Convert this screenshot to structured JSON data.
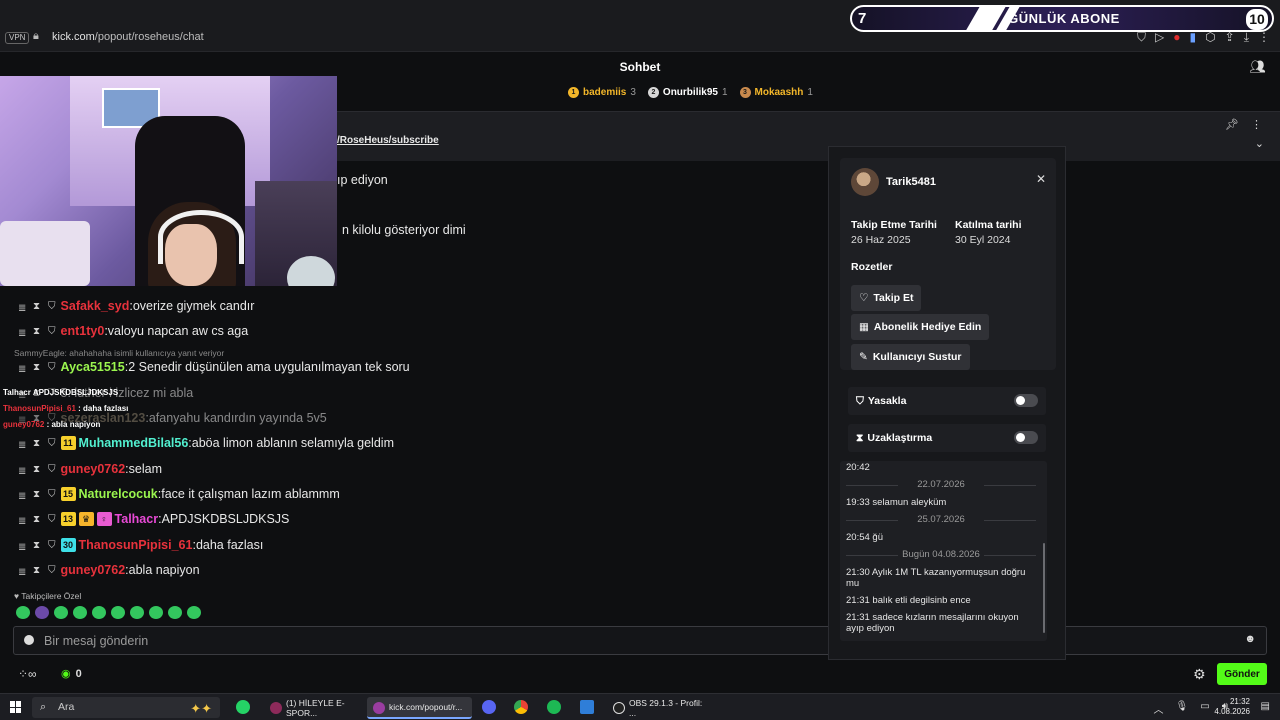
{
  "browser": {
    "vpn": "VPN",
    "url_host": "kick.com",
    "url_path": "/popout/roseheus/chat"
  },
  "overlay": {
    "left_number": "7",
    "title": "GÜNLÜK ABONE",
    "right_number": "10"
  },
  "header": {
    "title": "Sohbet"
  },
  "leaderboard": [
    {
      "rank": "1",
      "name": "bademiis",
      "count": "3",
      "color": "#f3b72a",
      "medal": "#f3b72a"
    },
    {
      "rank": "2",
      "name": "Onurbilik95",
      "count": "1",
      "color": "#ffffff",
      "medal": "#d7d7d7"
    },
    {
      "rank": "3",
      "name": "Mokaashh",
      "count": "1",
      "color": "#f3b72a",
      "medal": "#c98a4d"
    }
  ],
  "pinned": {
    "link": "/RoseHeus/subscribe"
  },
  "partials": [
    {
      "text": "ıp ediyon"
    },
    {
      "text": "n kilolu gösteriyor dimi"
    }
  ],
  "messages": [
    {
      "user": "Safakk_syd",
      "color": "#e8323c",
      "text": "overize giymek candır",
      "badges": []
    },
    {
      "user": "ent1ty0",
      "color": "#e8323c",
      "text": "valoyu napcan aw cs aga",
      "badges": []
    },
    {
      "user": "Ayca51515",
      "color": "#9bf64f",
      "text": "2 Senedir düşünülen ama uygulanılmayan tek soru",
      "badges": []
    },
    {
      "user": "",
      "color": "#e8e8e8",
      "text": "5: luther i izlicez mi abla",
      "badges": []
    },
    {
      "user": "sezeraslan123",
      "color": "#8a7f6a",
      "text": "afanyahu kandırdın yayında 5v5",
      "badges": []
    },
    {
      "user": "MuhammedBilal56",
      "color": "#52f0d0",
      "text": "aböa limon ablanın selamıyla geldim",
      "badges": [
        {
          "label": "11",
          "bg": "#f7d02c"
        }
      ]
    },
    {
      "user": "guney0762",
      "color": "#e8323c",
      "text": "selam",
      "badges": []
    },
    {
      "user": "Naturelcocuk",
      "color": "#9bf64f",
      "text": "face it çalışman lazım ablammm",
      "badges": [
        {
          "label": "15",
          "bg": "#f7d02c"
        }
      ]
    },
    {
      "user": "Talhacr",
      "color": "#e84ad6",
      "text": "APDJSKDBSLJDKSJS",
      "badges": [
        {
          "label": "13",
          "bg": "#f7d02c"
        },
        {
          "label": "♛",
          "bg": "#f7b52c"
        },
        {
          "label": "♀",
          "bg": "#e85bd1"
        }
      ]
    },
    {
      "user": "ThanosunPipisi_61",
      "color": "#e8323c",
      "text": "daha fazlası",
      "badges": [
        {
          "label": "30",
          "bg": "#3ee0e8"
        }
      ]
    },
    {
      "user": "guney0762",
      "color": "#e8323c",
      "text": "abla napiyon",
      "badges": []
    }
  ],
  "reply_hint": "SammyEagle: ahahahaha isimli kullanıcıya yanıt veriyor",
  "overlay_chat": [
    {
      "user": "Talhacr",
      "text": "APDJSKDBSLJDKSJS"
    },
    {
      "user": "ThanosunPipisi_61",
      "text": "daha fazlası"
    },
    {
      "user": "guney0762",
      "text": "abla napiyon"
    }
  ],
  "followers_only": "Takipçilere Özel",
  "input": {
    "placeholder": "Bir mesaj gönderin"
  },
  "bottom": {
    "points": "0",
    "send_label": "Gönder"
  },
  "popup": {
    "username": "Tarik5481",
    "follow_date_label": "Takip Etme Tarihi",
    "follow_date": "26 Haz 2025",
    "join_date_label": "Katılma tarihi",
    "join_date": "30 Eyl 2024",
    "badges_label": "Rozetler",
    "follow_btn": "Takip Et",
    "gift_btn": "Abonelik Hediye Edin",
    "mute_btn": "Kullanıcıyı Sustur",
    "ban_label": "Yasakla",
    "timeout_label": "Uzaklaştırma",
    "history": {
      "top_time": "20:42",
      "date1": "22.07.2026",
      "msg1": "19:33 selamun aleyküm",
      "date2": "25.07.2026",
      "msg2": "20:54 ğü",
      "date3": "Bugün 04.08.2026",
      "msg3": "21:30 Aylık 1M TL kazanıyormuşsun doğru mu",
      "msg4": "21:31 balık etli degilsinb ence",
      "msg5": "21:31 sadece kızların mesajlarını okuyon ayıp ediyon"
    }
  },
  "taskbar": {
    "search": "Ara",
    "apps": [
      {
        "label": "(1) HİLEYLE E-SPOR..."
      },
      {
        "label": "kick.com/popout/r..."
      },
      {
        "label": "OBS 29.1.3 - Profil: ..."
      }
    ],
    "time": "21:32",
    "date": "4.08.2026"
  }
}
